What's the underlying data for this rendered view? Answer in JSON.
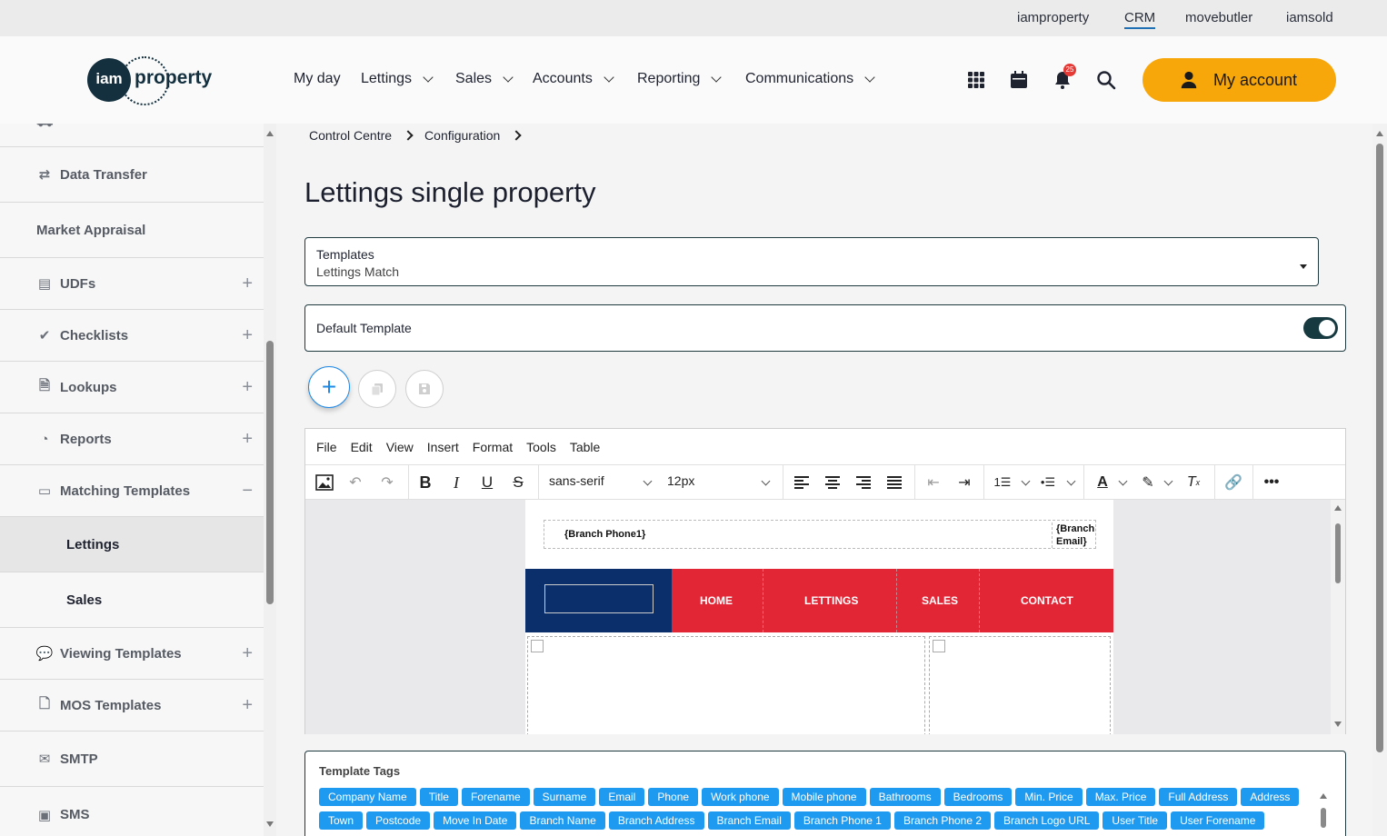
{
  "brand_links": [
    "iamproperty",
    "CRM",
    "movebutler",
    "iamsold"
  ],
  "brand_active": "CRM",
  "logo": {
    "short": "iam",
    "word": "property"
  },
  "nav": [
    "My day",
    "Lettings",
    "Sales",
    "Accounts",
    "Reporting",
    "Communications"
  ],
  "notifications_count": "25",
  "account_label": "My account",
  "sidebar": [
    {
      "label": "Data Transfer",
      "icon": "transfer-icon",
      "expandable": false
    },
    {
      "label": "Market Appraisal",
      "icon": "",
      "expandable": false
    },
    {
      "label": "UDFs",
      "icon": "list-icon",
      "expandable": true
    },
    {
      "label": "Checklists",
      "icon": "check-circle-icon",
      "expandable": true
    },
    {
      "label": "Lookups",
      "icon": "search-doc-icon",
      "expandable": true
    },
    {
      "label": "Reports",
      "icon": "pie-chart-icon",
      "expandable": true
    },
    {
      "label": "Matching Templates",
      "icon": "window-icon",
      "expandable": true,
      "expanded": true
    },
    {
      "label": "Lettings",
      "sub": true,
      "active": true
    },
    {
      "label": "Sales",
      "sub": true
    },
    {
      "label": "Viewing Templates",
      "icon": "comment-icon",
      "expandable": true
    },
    {
      "label": "MOS Templates",
      "icon": "document-icon",
      "expandable": true
    },
    {
      "label": "SMTP",
      "icon": "envelope-icon",
      "expandable": false
    },
    {
      "label": "SMS",
      "icon": "sms-icon",
      "expandable": false
    }
  ],
  "breadcrumb": [
    "Control Centre",
    "Configuration"
  ],
  "page_title": "Lettings single property",
  "templates_select": {
    "label": "Templates",
    "value": "Lettings Match"
  },
  "default_template_label": "Default Template",
  "default_template_on": true,
  "editor": {
    "menu": [
      "File",
      "Edit",
      "View",
      "Insert",
      "Format",
      "Tools",
      "Table"
    ],
    "font_family": "sans-serif",
    "font_size": "12px",
    "branch_phone": "{Branch Phone1}",
    "branch_email": "{Branch Email}",
    "nav_links": [
      "HOME",
      "LETTINGS",
      "SALES",
      "CONTACT"
    ]
  },
  "template_tags_title": "Template Tags",
  "template_tags": [
    "Company Name",
    "Title",
    "Forename",
    "Surname",
    "Email",
    "Phone",
    "Work phone",
    "Mobile phone",
    "Bathrooms",
    "Bedrooms",
    "Min. Price",
    "Max. Price",
    "Full Address",
    "Address",
    "Town",
    "Postcode",
    "Move In Date",
    "Branch Name",
    "Branch Address",
    "Branch Email",
    "Branch Phone 1",
    "Branch Phone 2",
    "Branch Logo URL",
    "User Title",
    "User Forename"
  ],
  "colors": {
    "accent": "#f7a70a",
    "tag": "#1e9bf0",
    "nav_red": "#e32636",
    "nav_blue": "#0a2f6b"
  }
}
